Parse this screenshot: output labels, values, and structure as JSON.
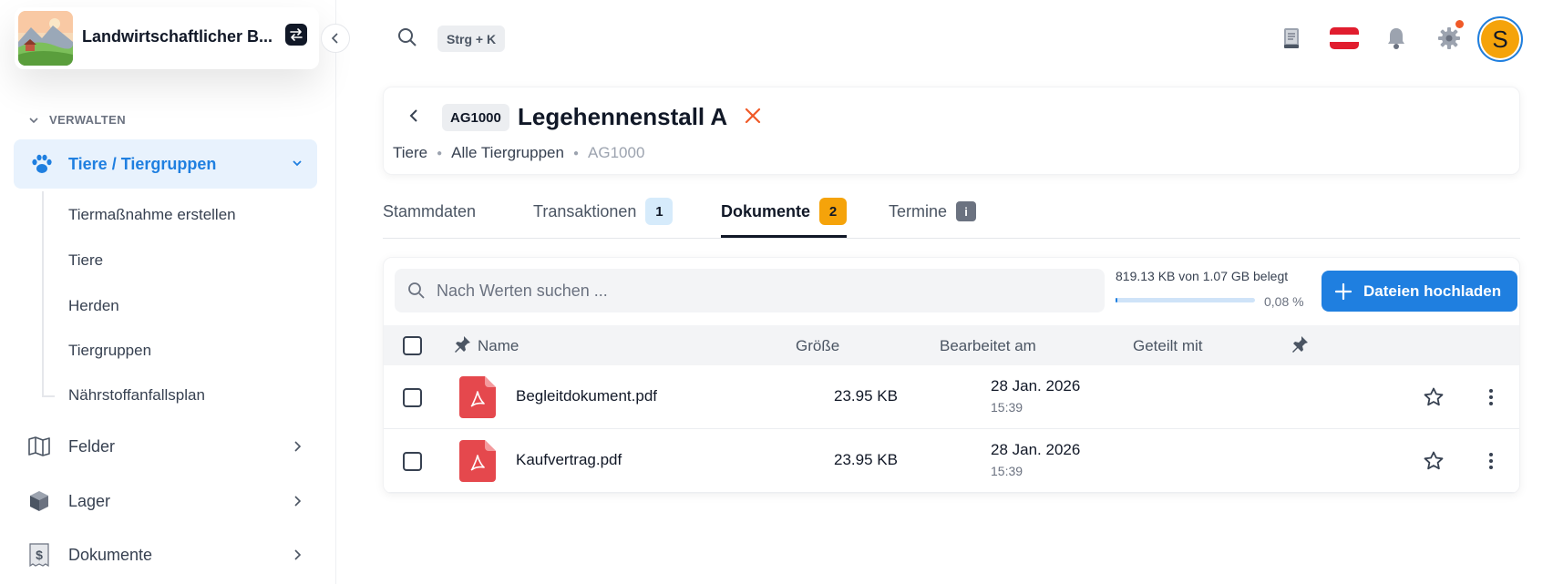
{
  "sidebar": {
    "org_name": "Landwirtschaftlicher B...",
    "section_label": "VERWALTEN",
    "active_item": "Tiere / Tiergruppen",
    "sub_items": [
      "Tiermaßnahme erstellen",
      "Tiere",
      "Herden",
      "Tiergruppen",
      "Nährstoffanfallsplan"
    ],
    "items": [
      {
        "label": "Felder",
        "icon": "book-map-icon"
      },
      {
        "label": "Lager",
        "icon": "box-icon"
      },
      {
        "label": "Dokumente",
        "icon": "receipt-icon"
      }
    ]
  },
  "topbar": {
    "shortcut": "Strg + K",
    "avatar_initial": "S",
    "icons": [
      "search-icon",
      "guide-book-icon",
      "austria-flag-icon",
      "bell-icon",
      "gear-icon"
    ]
  },
  "header": {
    "code": "AG1000",
    "title": "Legehennenstall A",
    "breadcrumb": [
      "Tiere",
      "Alle Tiergruppen",
      "AG1000"
    ]
  },
  "tabs": [
    {
      "label": "Stammdaten",
      "badge": ""
    },
    {
      "label": "Transaktionen",
      "badge": "1"
    },
    {
      "label": "Dokumente",
      "badge": "2"
    },
    {
      "label": "Termine",
      "badge": "i"
    }
  ],
  "files": {
    "search_placeholder": "Nach Werten suchen ...",
    "storage_text": "819.13 KB von 1.07 GB belegt",
    "storage_percent": "0,08 %",
    "storage_fraction": 0.0008,
    "upload_label": "Dateien hochladen",
    "columns": {
      "name": "Name",
      "size": "Größe",
      "edited": "Bearbeitet am",
      "shared": "Geteilt mit"
    },
    "rows": [
      {
        "name": "Begleitdokument.pdf",
        "size": "23.95 KB",
        "date": "28 Jan. 2026",
        "time": "15:39"
      },
      {
        "name": "Kaufvertrag.pdf",
        "size": "23.95 KB",
        "date": "28 Jan. 2026",
        "time": "15:39"
      }
    ]
  },
  "colors": {
    "accent": "#1f7fe0",
    "accent_bg": "#e8f2fd",
    "badge_orange": "#f5a30a",
    "badge_blue": "#d6ebfb",
    "pdf_red": "#e5484d",
    "close_red": "#f05a28"
  }
}
